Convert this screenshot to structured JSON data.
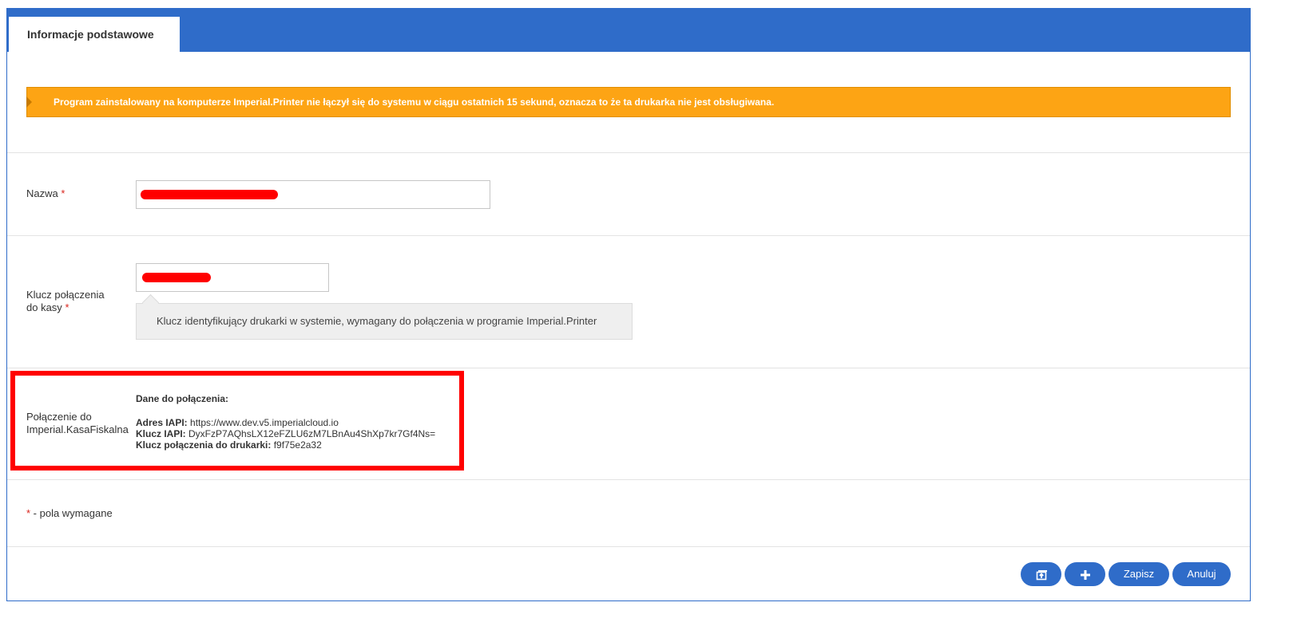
{
  "tabs": [
    {
      "label": "Informacje podstawowe"
    }
  ],
  "alert": {
    "text": "Program zainstalowany na komputerze Imperial.Printer nie łączył się do systemu w ciągu ostatnich 15 sekund, oznacza to że ta drukarka nie jest obsługiwana."
  },
  "form": {
    "name": {
      "label": "Nazwa",
      "required_mark": "*",
      "value": ""
    },
    "key": {
      "label_line1": "Klucz połączenia",
      "label_line2": "do kasy",
      "required_mark": "*",
      "value": "",
      "hint": "Klucz identyfikujący drukarki w systemie, wymagany do połączenia w programie Imperial.Printer"
    },
    "connection": {
      "label_line1": "Połączenie do",
      "label_line2": "Imperial.KasaFiskalna",
      "heading": "Dane do połączenia:",
      "iapi_address_label": "Adres IAPI:",
      "iapi_address_value": "https://www.dev.v5.imperialcloud.io",
      "iapi_key_label": "Klucz IAPI:",
      "iapi_key_value": "DyxFzP7AQhsLX12eFZLU6zM7LBnAu4ShXp7kr7Gf4Ns=",
      "printer_key_label": "Klucz połączenia do drukarki:",
      "printer_key_value": "f9f75e2a32"
    },
    "required_note": {
      "mark": "*",
      "text": " - pola wymagane"
    }
  },
  "buttons": {
    "icon1": "back-to-list-icon",
    "icon2": "plus-icon",
    "save": "Zapisz",
    "cancel": "Anuluj"
  },
  "colors": {
    "primary": "#2f6cc9",
    "warning": "#fda414",
    "required": "#d9241c",
    "highlight": "#ff0000"
  }
}
